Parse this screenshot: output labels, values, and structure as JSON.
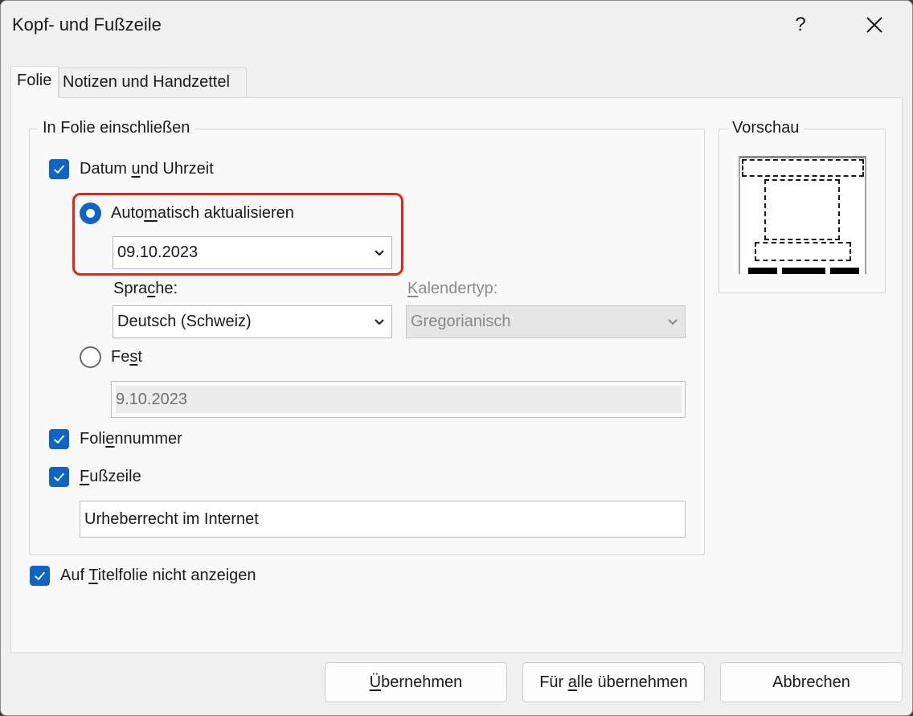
{
  "window": {
    "title": "Kopf- und Fußzeile",
    "help": "?",
    "close": "✕"
  },
  "tabs": [
    {
      "label": "Folie",
      "active": true
    },
    {
      "label": "Notizen und Handzettel",
      "active": false
    }
  ],
  "include_group": {
    "legend": "In Folie einschließen",
    "date_time": {
      "pre": "Datum ",
      "u": "u",
      "post": "nd Uhrzeit",
      "checked": true
    },
    "auto_update": {
      "pre": "Auto",
      "u": "m",
      "post": "atisch aktualisieren",
      "selected": true
    },
    "date_format_value": "09.10.2023",
    "language": {
      "pre": "Spra",
      "u": "c",
      "post": "he:",
      "value": "Deutsch (Schweiz)"
    },
    "calendar": {
      "u": "K",
      "post": "alendertyp:",
      "value": "Gregorianisch"
    },
    "fixed": {
      "pre": "Fe",
      "u": "s",
      "post": "t",
      "selected": false,
      "value": "9.10.2023"
    },
    "slide_number": {
      "pre": "Foli",
      "u": "e",
      "post": "nnummer",
      "checked": true
    },
    "footer": {
      "u": "F",
      "post": "ußzeile",
      "checked": true,
      "value": "Urheberrecht im Internet"
    }
  },
  "title_slide": {
    "pre": "Auf ",
    "u": "T",
    "post": "itelfolie nicht anzeigen",
    "checked": true
  },
  "preview": {
    "legend": "Vorschau"
  },
  "buttons": {
    "apply": {
      "u": "Ü",
      "post": "bernehmen"
    },
    "apply_all": {
      "pre": "Für ",
      "u": "a",
      "post": "lle übernehmen"
    },
    "cancel": "Abbrechen"
  },
  "colors": {
    "accent": "#0f64c4",
    "highlight": "#e0251b"
  }
}
